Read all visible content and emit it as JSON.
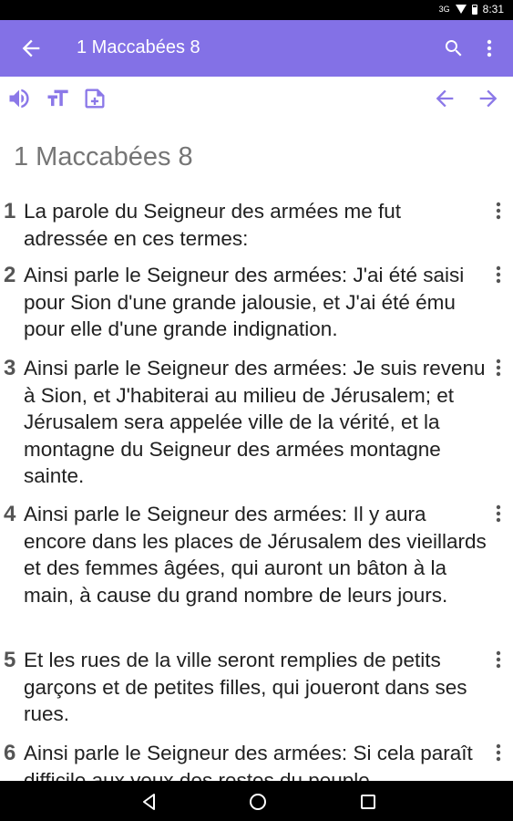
{
  "status": {
    "time": "8:31",
    "signal": "3G"
  },
  "appbar": {
    "title": "1 Maccabées 8"
  },
  "chapter_title": "1 Maccabées 8",
  "verses": [
    {
      "num": "1",
      "text": "La parole du Seigneur des armées me fut adressée en ces termes:"
    },
    {
      "num": "2",
      "text": "Ainsi parle le Seigneur des armées: J'ai été saisi pour Sion d'une grande jalousie, et J'ai été ému pour elle d'une grande indignation."
    },
    {
      "num": "3",
      "text": "Ainsi parle le Seigneur des armées: Je suis revenu à Sion, et J'habiterai au milieu de Jérusalem; et Jérusalem sera appelée ville de la vérité, et la montagne du Seigneur des armées montagne sainte."
    },
    {
      "num": "4",
      "text": "Ainsi parle le Seigneur des armées: Il y aura encore dans les places de Jérusalem des vieillards et des femmes âgées, qui auront un bâton à la main, à cause du grand nombre de leurs jours."
    },
    {
      "num": "5",
      "text": "Et les rues de la ville seront remplies de petits garçons et de petites filles, qui joueront dans ses rues."
    },
    {
      "num": "6",
      "text": "Ainsi parle le Seigneur des armées: Si cela paraît difficile aux yeux des restes du peuple"
    }
  ],
  "colors": {
    "accent": "#8371e6",
    "icon": "#8b78e8"
  }
}
